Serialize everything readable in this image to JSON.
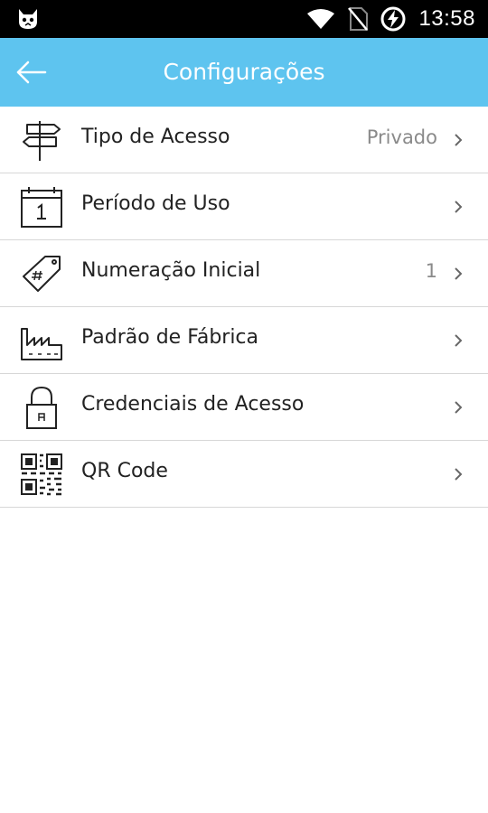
{
  "status_bar": {
    "time": "13:58",
    "left_icon": "cat-face-icon",
    "icons": [
      "wifi-icon",
      "no-sim-icon",
      "battery-charging-icon"
    ]
  },
  "app_bar": {
    "title": "Configurações",
    "back_icon": "arrow-left-icon",
    "color": "#5ec4ef"
  },
  "settings": {
    "items": [
      {
        "label": "Tipo de Acesso",
        "value": "Privado",
        "icon": "signpost-icon"
      },
      {
        "label": "Período de Uso",
        "value": "",
        "icon": "calendar-icon"
      },
      {
        "label": "Numeração Inicial",
        "value": "1",
        "icon": "tag-icon"
      },
      {
        "label": "Padrão de Fábrica",
        "value": "",
        "icon": "factory-icon"
      },
      {
        "label": "Credenciais de Acesso",
        "value": "",
        "icon": "lock-icon"
      },
      {
        "label": "QR Code",
        "value": "",
        "icon": "qr-code-icon"
      }
    ]
  }
}
